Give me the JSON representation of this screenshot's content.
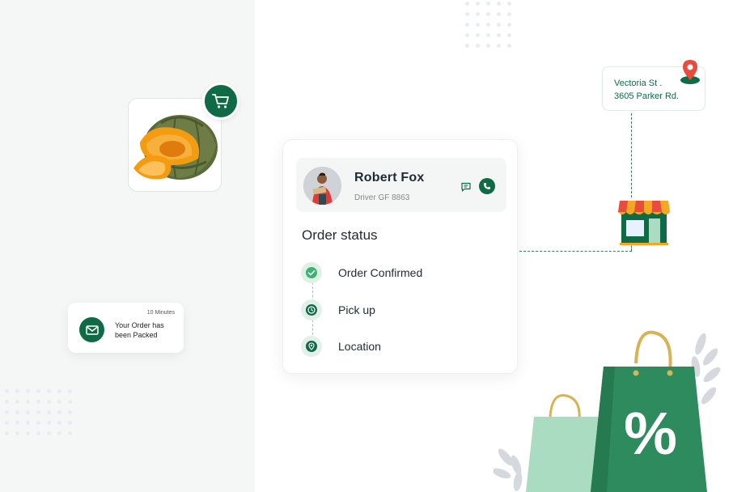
{
  "product_card": {
    "icon": "pumpkin-image",
    "action_icon": "cart-icon"
  },
  "notification": {
    "time": "10 Minutes",
    "message": "Your Order has been Packed",
    "icon": "mail-icon"
  },
  "driver": {
    "name": "Robert Fox",
    "id": "Driver GF 8863",
    "actions": [
      "chat-icon",
      "phone-icon"
    ]
  },
  "order_status": {
    "title": "Order status",
    "steps": [
      {
        "label": "Order Confirmed",
        "icon": "check-icon",
        "state": "done"
      },
      {
        "label": "Pick up",
        "icon": "clock-icon",
        "state": "pending"
      },
      {
        "label": "Location",
        "icon": "location-pin-icon",
        "state": "pending"
      }
    ]
  },
  "address": {
    "line1": "Vectoria  St .",
    "line2": "3605 Parker Rd."
  },
  "discount_icon": "%",
  "colors": {
    "primary": "#0e6b46",
    "light_green": "#a9dcc0",
    "accent_red": "#e74c3c",
    "pale_bg": "#f5f7f6"
  }
}
